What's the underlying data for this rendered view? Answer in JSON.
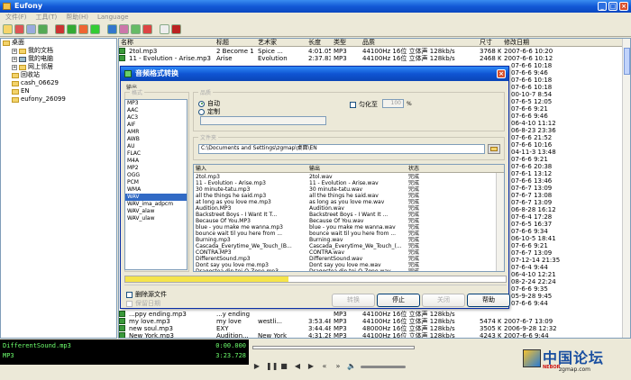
{
  "window": {
    "title": "Eufony"
  },
  "menu": [
    "文件(F)",
    "工具(T)",
    "帮助(H)",
    "Language"
  ],
  "tree": [
    {
      "label": "桌面",
      "kind": "folder",
      "level": 0
    },
    {
      "label": "我的文档",
      "kind": "folder",
      "level": 1,
      "expand": "+"
    },
    {
      "label": "我的电脑",
      "kind": "pc",
      "level": 1,
      "expand": "+"
    },
    {
      "label": "网上邻居",
      "kind": "folder",
      "level": 1,
      "expand": "+"
    },
    {
      "label": "回收站",
      "kind": "folder",
      "level": 1
    },
    {
      "label": "cash_06629",
      "kind": "folder",
      "level": 1
    },
    {
      "label": "EN",
      "kind": "folder",
      "level": 1
    },
    {
      "label": "eufony_26099",
      "kind": "folder",
      "level": 1
    }
  ],
  "list": {
    "columns": [
      "名称",
      "标题",
      "艺术家",
      "长度",
      "类型",
      "品质",
      "尺寸",
      "修改日期"
    ],
    "rows": [
      {
        "name": "2tol.mp3",
        "title": "2 Become 1",
        "artist": "Spice ...",
        "len": "4:01.057",
        "type": "MP3",
        "quality": "44100Hz 16位 立体声 128kb/s",
        "size": "3768 KB",
        "date": "2007-6-6 10:20"
      },
      {
        "name": "11 - Evolution - Arise.mp3",
        "title": "Arise",
        "artist": "Evolution",
        "len": "2:37.831",
        "type": "MP3",
        "quality": "44100Hz 16位 立体声 128kb/s",
        "size": "2468 KB",
        "date": "2007-6-6 10:12"
      }
    ],
    "dates_right": [
      "2007-6-6 10:20",
      "2007-6-6 10:12",
      "07-6-6 10:18",
      "07-6-6 9:46",
      "07-6-6 10:18",
      "07-6-6 10:18",
      "00-10-7 8:54",
      "07-6-5 12:05",
      "07-6-6 9:21",
      "07-6-6 9:46",
      "06-4-10 11:12",
      "06-8-23 23:36",
      "07-6-6 21:52",
      "07-6-6 10:16",
      "04-11-3 13:48",
      "07-6-6 9:21",
      "07-6-6 20:38",
      "07-6-1 13:12",
      "07-6-6 13:46",
      "07-6-7 13:09",
      "07-6-7 13:08",
      "07-6-7 13:09",
      "06-8-28 16:12",
      "07-6-4 17:28",
      "07-6-5 16:37",
      "07-6-6 9:34",
      "06-10-5 18:41",
      "07-6-6 9:21",
      "07-6-7 13:09",
      "07-12-14 21:35",
      "07-6-4 9:44",
      "06-4-10 12:21",
      "08-2-24 22:24",
      "07-6-6 9:35",
      "05-9-28 9:45",
      "07-6-6 9:44"
    ],
    "bottom_rows": [
      {
        "name": "...ppy ending.mp3",
        "title": "...y ending",
        "artist": "",
        "len": "",
        "type": "MP3",
        "quality": "44100Hz 16位 立体声 128kb/s",
        "size": "",
        "date": ""
      },
      {
        "name": "my love.mp3",
        "title": "my love",
        "artist": "westli...",
        "len": "3:53.482",
        "type": "MP3",
        "quality": "44100Hz 16位 立体声 128kb/s",
        "size": "5474 KB",
        "date": "2007-6-7 13:09"
      },
      {
        "name": "new soul.mp3",
        "title": "EXY",
        "artist": "",
        "len": "3:44.480",
        "type": "MP3",
        "quality": "48000Hz 16位 立体声 128kb/s",
        "size": "3505 KB",
        "date": "2006-9-28 12:32"
      },
      {
        "name": "New York.mp3",
        "title": "Audition...",
        "artist": "New York",
        "len": "4:31.281",
        "type": "MP3",
        "quality": "44100Hz 16位 立体声 128kb/s",
        "size": "4243 KB",
        "date": "2007-6-6 9:44"
      }
    ]
  },
  "player": {
    "track": "DifferentSound.mp3",
    "time1": "0:00.000",
    "format": "MP3",
    "time2": "3:23.728"
  },
  "logo": {
    "text": "中国论坛",
    "url": "zgmap.com",
    "net": "NEBOR"
  },
  "dialog": {
    "title": "音频格式转换",
    "output_label": "输出",
    "format_label": "格式",
    "formats": [
      "MP3",
      "AAC",
      "AC3",
      "AIF",
      "AMR",
      "AWB",
      "AU",
      "FLAC",
      "M4A",
      "MP2",
      "OGG",
      "PCM",
      "WMA",
      "WAV",
      "WAV_ima_adpcm",
      "WAV_alaw",
      "WAV_ulaw"
    ],
    "selected_format": "WAV",
    "quality_label": "品质",
    "auto_label": "自动",
    "custom_label": "定制",
    "normalize_label": "匀化至",
    "normalize_value": "100",
    "normalize_unit": "%",
    "folder_label": "文件夹",
    "folder_value": "C:\\Documents and Settings\\zgmap\\桌面\\EN",
    "table_cols": [
      "输入",
      "输出",
      "状态"
    ],
    "files": [
      {
        "in": "2tol.mp3",
        "out": "2tol.wav",
        "status": "完成"
      },
      {
        "in": "11 - Evolution - Arise.mp3",
        "out": "11 - Evolution - Arise.wav",
        "status": "完成"
      },
      {
        "in": "30 minute-tatu.mp3",
        "out": "30 minute-tatu.wav",
        "status": "完成"
      },
      {
        "in": "all the things he said.mp3",
        "out": "all the things he said.wav",
        "status": "完成"
      },
      {
        "in": "at long as you love me.mp3",
        "out": "as long as you love me.wav",
        "status": "完成"
      },
      {
        "in": "Audition.MP3",
        "out": "Audition.wav",
        "status": "完成"
      },
      {
        "in": "Backstreet Boys - I Want It T...",
        "out": "Backstreet Boys - I Want It ...",
        "status": "完成"
      },
      {
        "in": "Because Of You.MP3",
        "out": "Because Of You.wav",
        "status": "完成"
      },
      {
        "in": "blue - you make me wanna.mp3",
        "out": "blue - you make me wanna.wav",
        "status": "完成"
      },
      {
        "in": "bounce wait til you here from ...",
        "out": "bounce wait til you here from ...",
        "status": "完成"
      },
      {
        "in": "Burning.mp3",
        "out": "Burning.wav",
        "status": "完成"
      },
      {
        "in": "Cascada_Everytime_We_Touch_(B...",
        "out": "Cascada_Everytime_We_Touch_(...",
        "status": "完成"
      },
      {
        "in": "CONTRA.MP3",
        "out": "CONTRA.wav",
        "status": "完成"
      },
      {
        "in": "DifferentSound.mp3",
        "out": "DifferentSound.wav",
        "status": "完成"
      },
      {
        "in": "Dont say you love me.mp3",
        "out": "Dont say you love me.wav",
        "status": "完成"
      },
      {
        "in": "Dragostea din tei-O-Zone.mp3",
        "out": "Dragostea din tei-O-Zone.wav",
        "status": "完成"
      }
    ],
    "progress": 0.43,
    "delete_source_label": "删除源文件",
    "keep_date_label": "保留日期",
    "btn_convert": "转换",
    "btn_stop": "停止",
    "btn_close": "关闭",
    "btn_help": "帮助"
  }
}
